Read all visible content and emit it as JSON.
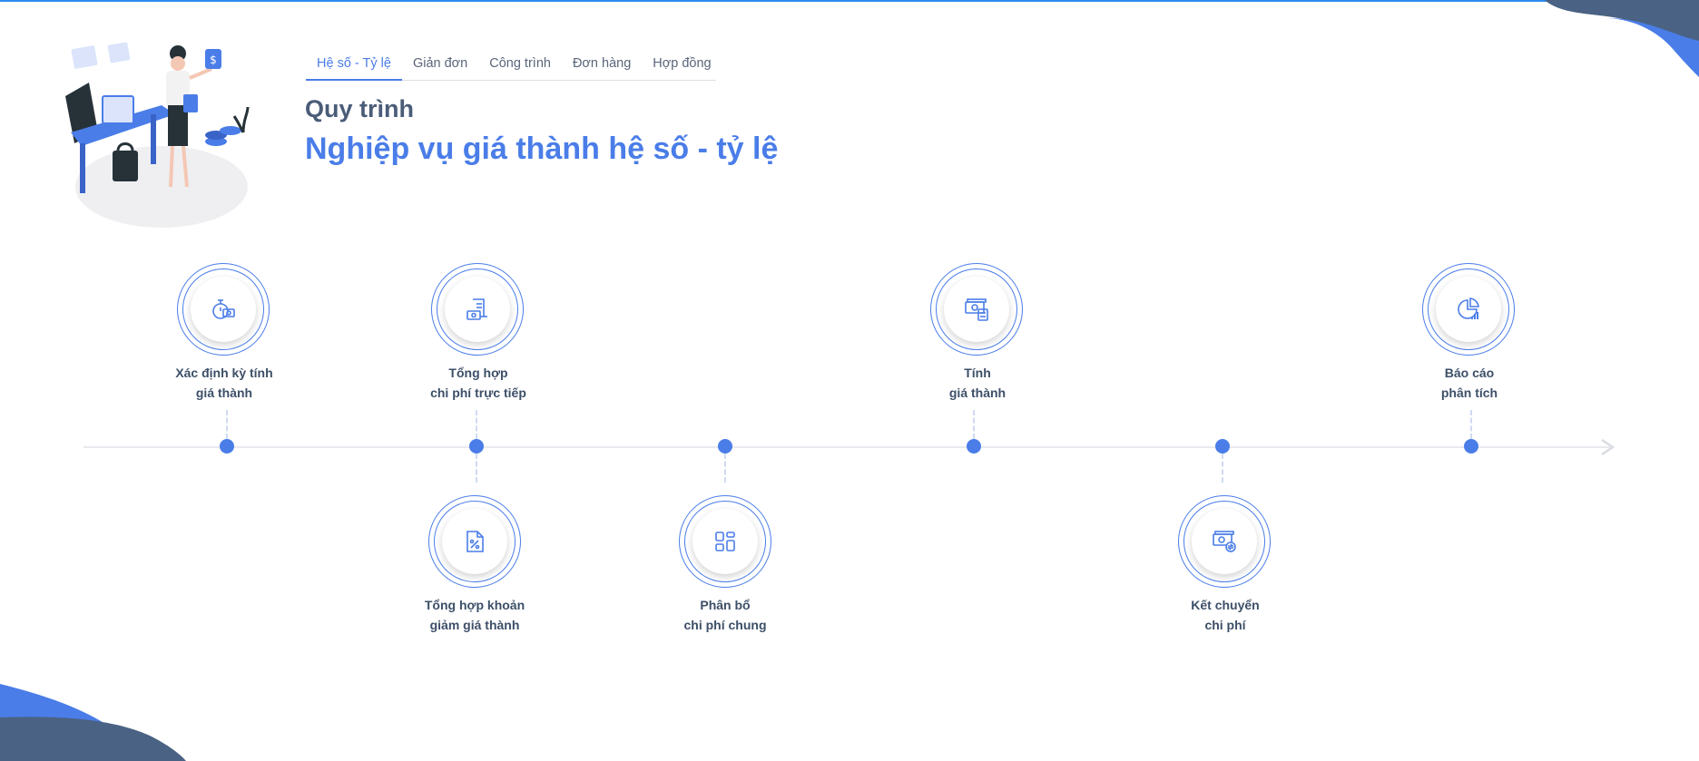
{
  "tabs": [
    {
      "label": "Hệ số - Tỷ lệ",
      "active": true
    },
    {
      "label": "Giản đơn",
      "active": false
    },
    {
      "label": "Công trình",
      "active": false
    },
    {
      "label": "Đơn hàng",
      "active": false
    },
    {
      "label": "Hợp đồng",
      "active": false
    }
  ],
  "heading": {
    "subtitle": "Quy trình",
    "title": "Nghiệp vụ giá thành hệ số - tỷ lệ"
  },
  "steps": [
    {
      "line1": "Xác định kỳ tính",
      "line2": "giá thành",
      "icon": "stopwatch-money-icon",
      "position": "above"
    },
    {
      "line1": "Tổng hợp khoản",
      "line2": "giảm giá thành",
      "icon": "percent-document-icon",
      "position": "below"
    },
    {
      "line1": "Tổng hợp",
      "line2": "chi phí trực tiếp",
      "icon": "receipt-money-icon",
      "position": "above"
    },
    {
      "line1": "Phân bổ",
      "line2": "chi phí chung",
      "icon": "grid-layout-icon",
      "position": "below"
    },
    {
      "line1": "Tính",
      "line2": "giá thành",
      "icon": "money-calculator-icon",
      "position": "above"
    },
    {
      "line1": "Kết chuyển",
      "line2": "chi phí",
      "icon": "money-transfer-icon",
      "position": "below"
    },
    {
      "line1": "Báo cáo",
      "line2": "phân tích",
      "icon": "pie-chart-bars-icon",
      "position": "above"
    }
  ],
  "colors": {
    "accent": "#4a7de8",
    "heading": "#4a5c78",
    "text": "#3d4f68",
    "top_bar": "#2f8cf0",
    "blob_dark": "#4a6283"
  }
}
